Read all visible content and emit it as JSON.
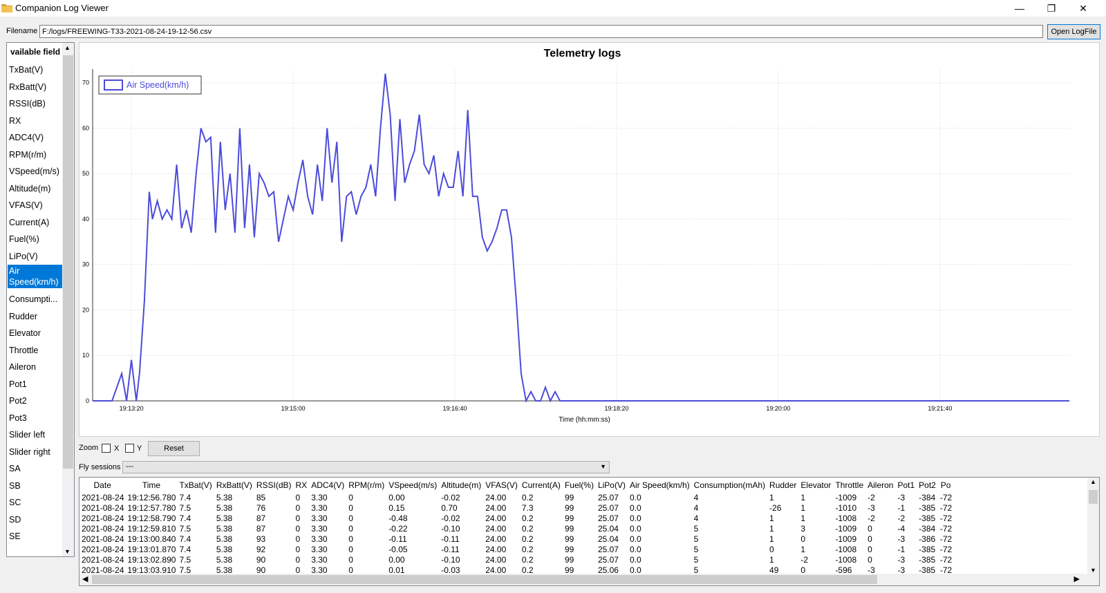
{
  "window": {
    "title": "Companion Log Viewer",
    "minimize_glyph": "—",
    "maximize_glyph": "❐",
    "close_glyph": "✕"
  },
  "file": {
    "label": "Filename",
    "value": "F:/logs/FREEWING-T33-2021-08-24-19-12-56.csv",
    "open_button": "Open LogFile"
  },
  "fields": {
    "header": "vailable field",
    "items": [
      "TxBat(V)",
      "RxBatt(V)",
      "RSSI(dB)",
      "RX",
      "ADC4(V)",
      "RPM(r/m)",
      "VSpeed(m/s)",
      "Altitude(m)",
      "VFAS(V)",
      "Current(A)",
      "Fuel(%)",
      "LiPo(V)",
      "Air Speed(km/h)",
      "Consumpti...",
      "Rudder",
      "Elevator",
      "Throttle",
      "Aileron",
      "Pot1",
      "Pot2",
      "Pot3",
      "Slider left",
      "Slider right",
      "SA",
      "SB",
      "SC",
      "SD",
      "SE"
    ],
    "selected_index": 12
  },
  "chart_data": {
    "type": "line",
    "title": "Telemetry logs",
    "xlabel": "Time (hh:mm:ss)",
    "ylabel": "",
    "x_tick_labels": [
      "19:13:20",
      "19:15:00",
      "19:16:40",
      "19:18:20",
      "19:20:00",
      "19:21:40"
    ],
    "y_tick_labels": [
      "0",
      "10",
      "20",
      "30",
      "40",
      "50",
      "60",
      "70"
    ],
    "ylim": [
      0,
      73
    ],
    "xlim": [
      "19:12:56",
      "19:23:00"
    ],
    "grid": true,
    "legend_position": "top-left",
    "series": [
      {
        "name": "Air Speed(km/h)",
        "color": "#4b4bdb",
        "x": [
          "19:12:56",
          "19:13:08",
          "19:13:14",
          "19:13:17",
          "19:13:20",
          "19:13:23",
          "19:13:25",
          "19:13:28",
          "19:13:31",
          "19:13:33",
          "19:13:36",
          "19:13:39",
          "19:13:42",
          "19:13:45",
          "19:13:48",
          "19:13:51",
          "19:13:54",
          "19:13:57",
          "19:14:00",
          "19:14:03",
          "19:14:06",
          "19:14:09",
          "19:14:12",
          "19:14:15",
          "19:14:18",
          "19:14:21",
          "19:14:24",
          "19:14:27",
          "19:14:30",
          "19:14:33",
          "19:14:36",
          "19:14:39",
          "19:14:42",
          "19:14:45",
          "19:14:48",
          "19:14:51",
          "19:14:54",
          "19:14:57",
          "19:15:00",
          "19:15:03",
          "19:15:06",
          "19:15:09",
          "19:15:12",
          "19:15:15",
          "19:15:18",
          "19:15:21",
          "19:15:24",
          "19:15:27",
          "19:15:30",
          "19:15:33",
          "19:15:36",
          "19:15:39",
          "19:15:42",
          "19:15:45",
          "19:15:48",
          "19:15:51",
          "19:15:54",
          "19:15:57",
          "19:16:00",
          "19:16:03",
          "19:16:06",
          "19:16:09",
          "19:16:12",
          "19:16:15",
          "19:16:18",
          "19:16:21",
          "19:16:24",
          "19:16:27",
          "19:16:30",
          "19:16:33",
          "19:16:36",
          "19:16:39",
          "19:16:42",
          "19:16:45",
          "19:16:48",
          "19:16:51",
          "19:16:54",
          "19:16:57",
          "19:17:00",
          "19:17:03",
          "19:17:06",
          "19:17:09",
          "19:17:12",
          "19:17:15",
          "19:17:18",
          "19:17:21",
          "19:17:24",
          "19:17:27",
          "19:17:30",
          "19:17:33",
          "19:17:36",
          "19:17:39",
          "19:17:42",
          "19:17:45",
          "19:17:48",
          "19:17:51",
          "19:17:54",
          "19:17:57",
          "19:18:00",
          "19:18:03",
          "19:18:06",
          "19:18:09",
          "19:18:12",
          "19:18:15",
          "19:18:18",
          "19:18:21",
          "19:18:24",
          "19:18:27",
          "19:18:30",
          "19:23:00"
        ],
        "values": [
          0,
          0,
          6,
          0,
          9,
          0,
          6,
          22,
          46,
          40,
          44,
          40,
          42,
          40,
          52,
          38,
          42,
          37,
          50,
          60,
          57,
          58,
          37,
          57,
          42,
          50,
          37,
          60,
          38,
          52,
          36,
          50,
          48,
          45,
          46,
          35,
          40,
          45,
          42,
          48,
          53,
          45,
          41,
          52,
          44,
          60,
          48,
          57,
          35,
          45,
          46,
          41,
          45,
          47,
          52,
          45,
          60,
          72,
          63,
          44,
          62,
          48,
          52,
          55,
          63,
          52,
          50,
          54,
          45,
          50,
          47,
          47,
          55,
          45,
          64,
          45,
          45,
          36,
          33,
          35,
          38,
          42,
          42,
          36,
          22,
          6,
          0,
          2,
          0,
          0,
          3,
          0,
          2,
          0,
          0,
          0,
          0,
          0,
          0,
          0,
          0,
          0,
          0,
          0,
          0,
          0,
          0,
          0,
          0,
          0
        ]
      }
    ]
  },
  "controls": {
    "zoom_label": "Zoom",
    "x_label": "X",
    "y_label": "Y",
    "reset": "Reset",
    "sessions_label": "Fly sessions",
    "sessions_value": "---"
  },
  "table": {
    "headers": [
      "Date",
      "Time",
      "TxBat(V)",
      "RxBatt(V)",
      "RSSI(dB)",
      "RX",
      "ADC4(V)",
      "RPM(r/m)",
      "VSpeed(m/s)",
      "Altitude(m)",
      "VFAS(V)",
      "Current(A)",
      "Fuel(%)",
      "LiPo(V)",
      "Air Speed(km/h)",
      "Consumption(mAh)",
      "Rudder",
      "Elevator",
      "Throttle",
      "Aileron",
      "Pot1",
      "Pot2",
      "Po"
    ],
    "rows": [
      [
        "2021-08-24",
        "19:12:56.780",
        "7.4",
        "5.38",
        "85",
        "0",
        "3.30",
        "0",
        "0.00",
        "-0.02",
        "24.00",
        "0.2",
        "99",
        "25.07",
        "0.0",
        "4",
        "1",
        "1",
        "-1009",
        "-2",
        "-3",
        "-384",
        "-72"
      ],
      [
        "2021-08-24",
        "19:12:57.780",
        "7.5",
        "5.38",
        "76",
        "0",
        "3.30",
        "0",
        "0.15",
        "0.70",
        "24.00",
        "7.3",
        "99",
        "25.07",
        "0.0",
        "4",
        "-26",
        "1",
        "-1010",
        "-3",
        "-1",
        "-385",
        "-72"
      ],
      [
        "2021-08-24",
        "19:12:58.790",
        "7.4",
        "5.38",
        "87",
        "0",
        "3.30",
        "0",
        "-0.48",
        "-0.02",
        "24.00",
        "0.2",
        "99",
        "25.07",
        "0.0",
        "4",
        "1",
        "1",
        "-1008",
        "-2",
        "-2",
        "-385",
        "-72"
      ],
      [
        "2021-08-24",
        "19:12:59.810",
        "7.5",
        "5.38",
        "87",
        "0",
        "3.30",
        "0",
        "-0.22",
        "-0.10",
        "24.00",
        "0.2",
        "99",
        "25.04",
        "0.0",
        "5",
        "1",
        "3",
        "-1009",
        "0",
        "-4",
        "-384",
        "-72"
      ],
      [
        "2021-08-24",
        "19:13:00.840",
        "7.4",
        "5.38",
        "93",
        "0",
        "3.30",
        "0",
        "-0.11",
        "-0.11",
        "24.00",
        "0.2",
        "99",
        "25.04",
        "0.0",
        "5",
        "1",
        "0",
        "-1009",
        "0",
        "-3",
        "-386",
        "-72"
      ],
      [
        "2021-08-24",
        "19:13:01.870",
        "7.4",
        "5.38",
        "92",
        "0",
        "3.30",
        "0",
        "-0.05",
        "-0.11",
        "24.00",
        "0.2",
        "99",
        "25.07",
        "0.0",
        "5",
        "0",
        "1",
        "-1008",
        "0",
        "-1",
        "-385",
        "-72"
      ],
      [
        "2021-08-24",
        "19:13:02.890",
        "7.5",
        "5.38",
        "90",
        "0",
        "3.30",
        "0",
        "0.00",
        "-0.10",
        "24.00",
        "0.2",
        "99",
        "25.07",
        "0.0",
        "5",
        "1",
        "-2",
        "-1008",
        "0",
        "-3",
        "-385",
        "-72"
      ],
      [
        "2021-08-24",
        "19:13:03.910",
        "7.5",
        "5.38",
        "90",
        "0",
        "3.30",
        "0",
        "0.01",
        "-0.03",
        "24.00",
        "0.2",
        "99",
        "25.06",
        "0.0",
        "5",
        "49",
        "0",
        "-596",
        "-3",
        "-3",
        "-385",
        "-72"
      ]
    ]
  }
}
